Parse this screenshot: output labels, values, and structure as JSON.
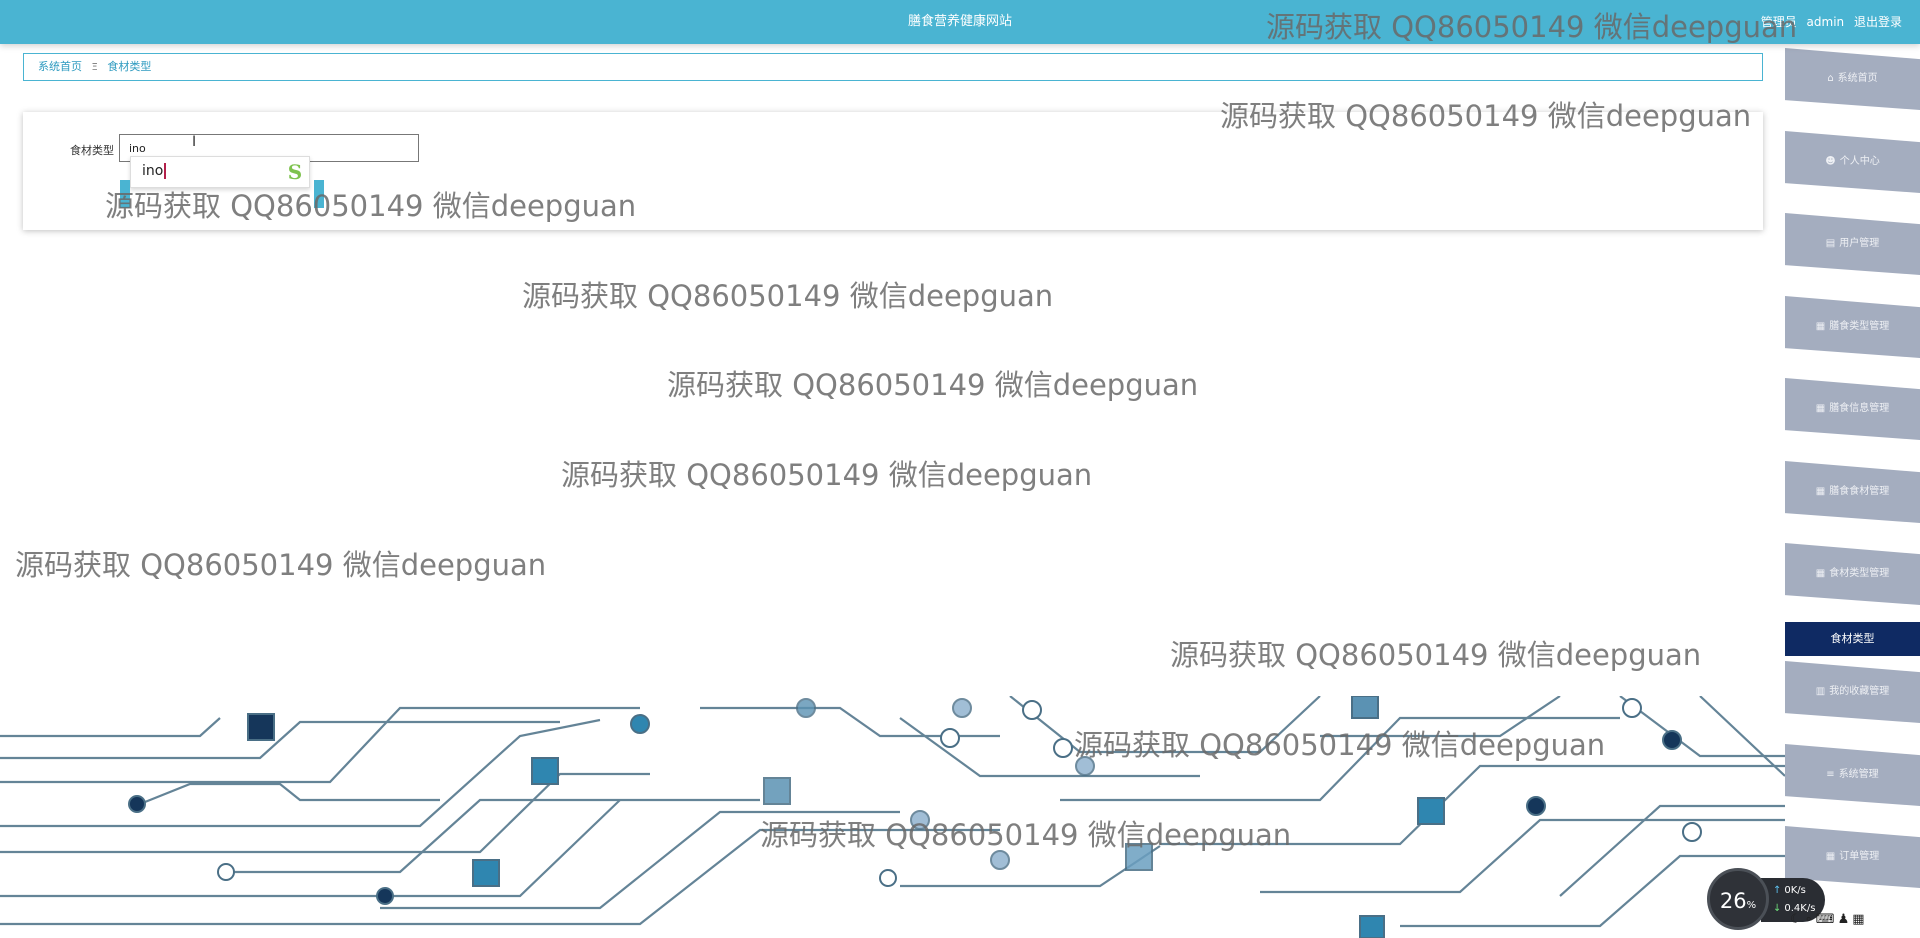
{
  "header": {
    "site_title": "膳食营养健康网站",
    "user_prefix": "管理员",
    "username": "admin",
    "logout_label": "退出登录"
  },
  "breadcrumb": {
    "home": "系统首页",
    "separator": "Ξ",
    "current": "食材类型"
  },
  "search": {
    "label": "食材类型",
    "value": "ino",
    "ime_composition": "ino",
    "ime_logo": "S"
  },
  "sidebar": {
    "items": [
      {
        "icon": "⌂",
        "label": "系统首页"
      },
      {
        "icon": "☻",
        "label": "个人中心"
      },
      {
        "icon": "▤",
        "label": "用户管理"
      },
      {
        "icon": "▦",
        "label": "膳食类型管理"
      },
      {
        "icon": "▦",
        "label": "膳食信息管理"
      },
      {
        "icon": "▦",
        "label": "膳食食材管理"
      },
      {
        "icon": "▦",
        "label": "食材类型管理"
      },
      {
        "icon": "",
        "label": "食材类型"
      },
      {
        "icon": "▥",
        "label": "我的收藏管理"
      },
      {
        "icon": "≡",
        "label": "系统管理"
      },
      {
        "icon": "▦",
        "label": "订单管理"
      }
    ]
  },
  "watermark": "源码获取 QQ86050149 微信deepguan",
  "system_widget": {
    "cpu_value": "26",
    "cpu_unit": "%",
    "upload": "0K/s",
    "download": "0.4K/s"
  },
  "colors": {
    "header": "#4ab4d2",
    "sidebar_item": "#a4adbf",
    "sidebar_active": "#0f2a63"
  }
}
